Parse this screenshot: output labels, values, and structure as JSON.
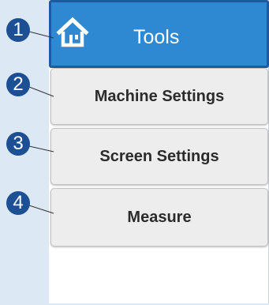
{
  "header": {
    "title": "Tools",
    "icon": "home-icon"
  },
  "menu": {
    "items": [
      {
        "label": "Machine Settings"
      },
      {
        "label": "Screen Settings"
      },
      {
        "label": "Measure"
      }
    ]
  },
  "callouts": [
    "1",
    "2",
    "3",
    "4"
  ],
  "colors": {
    "header_blue": "#2f89d2",
    "header_border": "#1f5aa0",
    "callout_blue": "#1c4f94",
    "button_gray": "#ededed",
    "background": "#dde8f5"
  }
}
